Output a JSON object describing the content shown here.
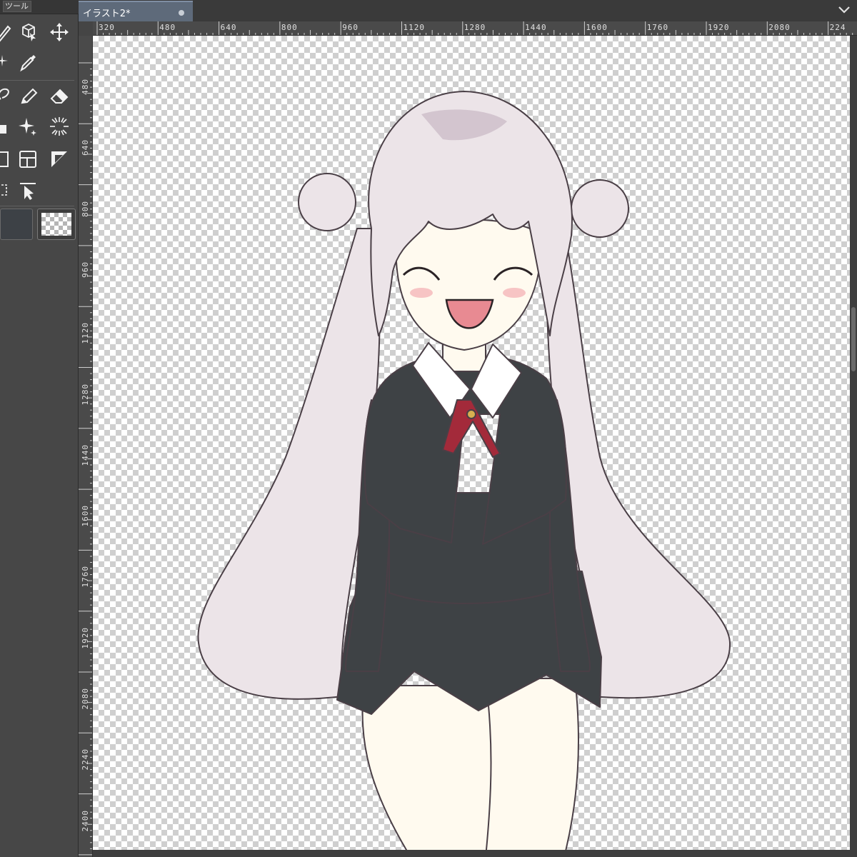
{
  "tool_panel": {
    "title": "ツール",
    "icons": [
      "pen-icon",
      "3d-object-icon",
      "move-icon",
      "magic-wand-icon",
      "eyedropper-icon",
      "lasso-icon",
      "marker-icon",
      "eraser-icon",
      "fill-bucket-icon",
      "sparkle-icon",
      "radial-lines-icon",
      "rectangle-icon",
      "frame-border-icon",
      "ruler-triangle-icon",
      "selection-icon",
      "object-select-icon"
    ],
    "main_color": "#3d4146",
    "sub_color": "transparent"
  },
  "document": {
    "tab_title": "イラスト2*",
    "modified": true
  },
  "rulers": {
    "horizontal": [
      "320",
      "480",
      "640",
      "800",
      "960",
      "1120",
      "1280",
      "1440",
      "1600",
      "1760",
      "1920",
      "2080",
      "224"
    ],
    "vertical": [
      "480",
      "640",
      "800",
      "960",
      "1120",
      "1280",
      "1440",
      "1600",
      "1760",
      "1920",
      "2080",
      "2240",
      "2400"
    ]
  },
  "colors": {
    "hair": "#ece4e8",
    "hair_shade": "#d3c5cf",
    "uniform": "#3e4245",
    "ribbon": "#a32a3a",
    "skin": "#fffaef",
    "blush": "#f7c4c4"
  }
}
